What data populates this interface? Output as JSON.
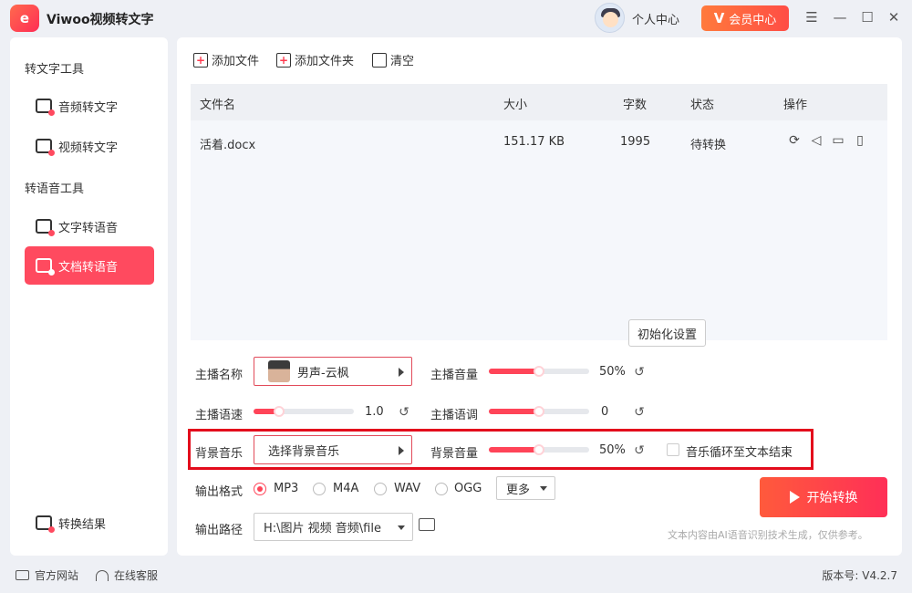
{
  "app": {
    "title": "Viwoo视频转文字",
    "logo_text": "e"
  },
  "header": {
    "personal_center": "个人中心",
    "vip_label": "会员中心",
    "vip_icon": "V"
  },
  "window_controls": {
    "menu": "☰",
    "minimize": "—",
    "maximize": "☐",
    "close": "✕"
  },
  "sidebar": {
    "group1": "转文字工具",
    "group2": "转语音工具",
    "items": [
      {
        "label": "音频转文字",
        "icon": "audio-to-text-icon"
      },
      {
        "label": "视频转文字",
        "icon": "video-to-text-icon"
      },
      {
        "label": "文字转语音",
        "icon": "text-to-speech-icon"
      },
      {
        "label": "文档转语音",
        "icon": "doc-to-speech-icon",
        "active": true
      }
    ],
    "result": "转换结果"
  },
  "toolbar": {
    "add_file": "添加文件",
    "add_folder": "添加文件夹",
    "clear": "清空"
  },
  "table": {
    "headers": [
      "文件名",
      "大小",
      "字数",
      "状态",
      "操作"
    ],
    "rows": [
      {
        "name": "活着.docx",
        "size": "151.17 KB",
        "words": "1995",
        "status": "待转换"
      }
    ]
  },
  "settings": {
    "anchor_name_label": "主播名称",
    "anchor_name_value": "男声-云枫",
    "anchor_volume_label": "主播音量",
    "anchor_volume_value": "50%",
    "anchor_volume_level": 0.5,
    "anchor_speed_label": "主播语速",
    "anchor_speed_value": "1.0",
    "anchor_speed_level": 0.25,
    "anchor_pitch_label": "主播语调",
    "anchor_pitch_value": "0",
    "anchor_pitch_level": 0.5,
    "init_button": "初始化设置",
    "bg_music_label": "背景音乐",
    "bg_music_value": "选择背景音乐",
    "bg_volume_label": "背景音量",
    "bg_volume_value": "50%",
    "bg_volume_level": 0.5,
    "loop_label": "音乐循环至文本结束",
    "format_label": "输出格式",
    "formats": [
      "MP3",
      "M4A",
      "WAV",
      "OGG"
    ],
    "selected_format": "MP3",
    "more_label": "更多",
    "path_label": "输出路径",
    "path_value": "H:\\图片 视频 音频\\file"
  },
  "actions": {
    "start": "开始转换"
  },
  "footer": {
    "disclaimer": "文本内容由AI语音识别技术生成，仅供参考。",
    "official_site": "官方网站",
    "online_service": "在线客服",
    "version": "版本号: V4.2.7"
  },
  "colors": {
    "accent": "#ff4458",
    "highlight": "#e30c1c"
  }
}
